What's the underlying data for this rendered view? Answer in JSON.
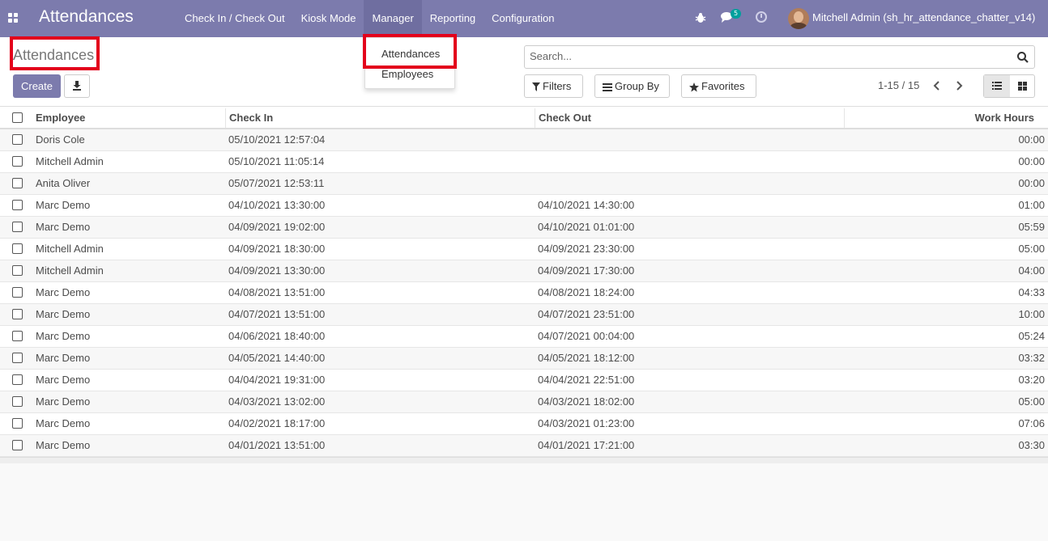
{
  "navbar": {
    "brand": "Attendances",
    "menu": [
      "Check In / Check Out",
      "Kiosk Mode",
      "Manager",
      "Reporting",
      "Configuration"
    ],
    "chat_count": "5",
    "user": "Mitchell Admin (sh_hr_attendance_chatter_v14)"
  },
  "dropdown": {
    "items": [
      "Attendances",
      "Employees"
    ]
  },
  "control": {
    "title": "Attendances",
    "create_label": "Create",
    "search_placeholder": "Search...",
    "filters_label": "Filters",
    "groupby_label": "Group By",
    "favorites_label": "Favorites",
    "pager": "1-15 / 15"
  },
  "table": {
    "headers": [
      "Employee",
      "Check In",
      "Check Out",
      "Work Hours"
    ],
    "rows": [
      [
        "Doris Cole",
        "05/10/2021 12:57:04",
        "",
        "00:00"
      ],
      [
        "Mitchell Admin",
        "05/10/2021 11:05:14",
        "",
        "00:00"
      ],
      [
        "Anita Oliver",
        "05/07/2021 12:53:11",
        "",
        "00:00"
      ],
      [
        "Marc Demo",
        "04/10/2021 13:30:00",
        "04/10/2021 14:30:00",
        "01:00"
      ],
      [
        "Marc Demo",
        "04/09/2021 19:02:00",
        "04/10/2021 01:01:00",
        "05:59"
      ],
      [
        "Mitchell Admin",
        "04/09/2021 18:30:00",
        "04/09/2021 23:30:00",
        "05:00"
      ],
      [
        "Mitchell Admin",
        "04/09/2021 13:30:00",
        "04/09/2021 17:30:00",
        "04:00"
      ],
      [
        "Marc Demo",
        "04/08/2021 13:51:00",
        "04/08/2021 18:24:00",
        "04:33"
      ],
      [
        "Marc Demo",
        "04/07/2021 13:51:00",
        "04/07/2021 23:51:00",
        "10:00"
      ],
      [
        "Marc Demo",
        "04/06/2021 18:40:00",
        "04/07/2021 00:04:00",
        "05:24"
      ],
      [
        "Marc Demo",
        "04/05/2021 14:40:00",
        "04/05/2021 18:12:00",
        "03:32"
      ],
      [
        "Marc Demo",
        "04/04/2021 19:31:00",
        "04/04/2021 22:51:00",
        "03:20"
      ],
      [
        "Marc Demo",
        "04/03/2021 13:02:00",
        "04/03/2021 18:02:00",
        "05:00"
      ],
      [
        "Marc Demo",
        "04/02/2021 18:17:00",
        "04/03/2021 01:23:00",
        "07:06"
      ],
      [
        "Marc Demo",
        "04/01/2021 13:51:00",
        "04/01/2021 17:21:00",
        "03:30"
      ]
    ]
  },
  "colors": {
    "navbar": "#7c7bad",
    "highlight": "#e3001b",
    "badge": "#00a09d"
  }
}
